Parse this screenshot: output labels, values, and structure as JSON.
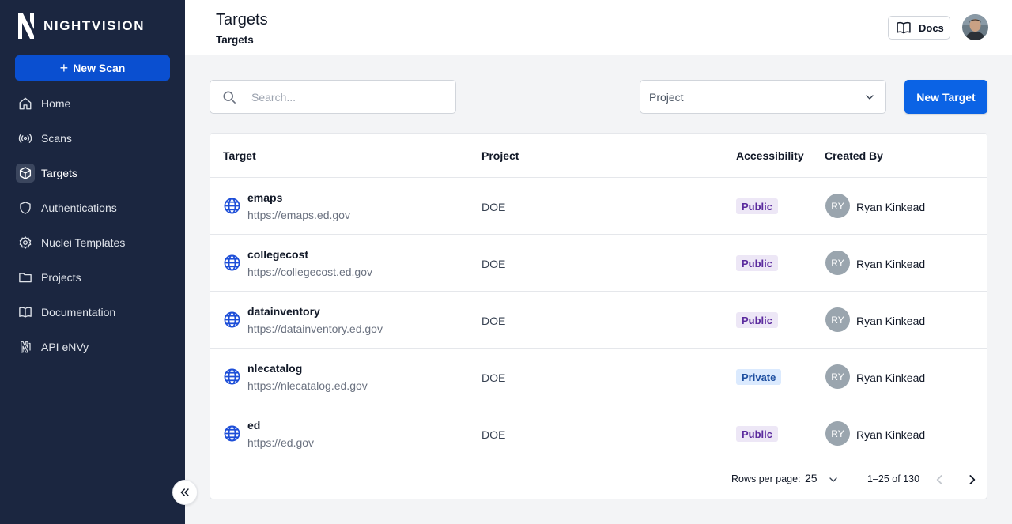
{
  "sidebar": {
    "brand": "NIGHTVISION",
    "new_scan_label": "New Scan",
    "items": [
      {
        "label": "Home",
        "icon": "home-icon"
      },
      {
        "label": "Scans",
        "icon": "broadcast-icon"
      },
      {
        "label": "Targets",
        "icon": "cube-icon",
        "active": true
      },
      {
        "label": "Authentications",
        "icon": "shield-icon"
      },
      {
        "label": "Nuclei Templates",
        "icon": "gear-icon"
      },
      {
        "label": "Projects",
        "icon": "folder-icon"
      },
      {
        "label": "Documentation",
        "icon": "book-icon"
      },
      {
        "label": "API eNVy",
        "icon": "api-envy-icon"
      }
    ]
  },
  "header": {
    "title": "Targets",
    "breadcrumb": "Targets",
    "docs_label": "Docs"
  },
  "toolbar": {
    "search_placeholder": "Search...",
    "project_placeholder": "Project",
    "new_target_label": "New Target"
  },
  "table": {
    "columns": {
      "target": "Target",
      "project": "Project",
      "accessibility": "Accessibility",
      "created_by": "Created By"
    },
    "rows": [
      {
        "name": "emaps",
        "url": "https://emaps.ed.gov",
        "project": "DOE",
        "access": "Public",
        "initials": "RY",
        "user": "Ryan Kinkead"
      },
      {
        "name": "collegecost",
        "url": "https://collegecost.ed.gov",
        "project": "DOE",
        "access": "Public",
        "initials": "RY",
        "user": "Ryan Kinkead"
      },
      {
        "name": "datainventory",
        "url": "https://datainventory.ed.gov",
        "project": "DOE",
        "access": "Public",
        "initials": "RY",
        "user": "Ryan Kinkead"
      },
      {
        "name": "nlecatalog",
        "url": "https://nlecatalog.ed.gov",
        "project": "DOE",
        "access": "Private",
        "initials": "RY",
        "user": "Ryan Kinkead"
      },
      {
        "name": "ed",
        "url": "https://ed.gov",
        "project": "DOE",
        "access": "Public",
        "initials": "RY",
        "user": "Ryan Kinkead"
      }
    ]
  },
  "pagination": {
    "rows_per_page_label": "Rows per page:",
    "rows_per_page": "25",
    "range": "1–25 of 130"
  },
  "colors": {
    "sidebar_bg": "#1b2640",
    "primary": "#0b63e5",
    "globe": "#1d4ed8",
    "public_badge": "#ede7f6",
    "private_badge": "#dbeafe"
  }
}
